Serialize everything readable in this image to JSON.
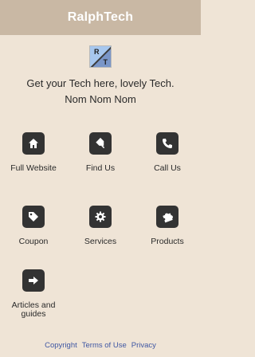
{
  "header": {
    "title": "RalphTech"
  },
  "logo": {
    "letter_1": "R",
    "letter_2": "T"
  },
  "tagline": "Get your Tech here, lovely Tech. Nom Nom Nom",
  "tiles": [
    {
      "label": "Full Website",
      "icon": "home-icon"
    },
    {
      "label": "Find Us",
      "icon": "map-pin-icon"
    },
    {
      "label": "Call Us",
      "icon": "phone-icon"
    },
    {
      "label": "Coupon",
      "icon": "tag-icon"
    },
    {
      "label": "Services",
      "icon": "gear-icon"
    },
    {
      "label": "Products",
      "icon": "puzzle-icon"
    },
    {
      "label": "Articles and guides",
      "icon": "arrow-right-icon"
    }
  ],
  "footer": {
    "links": [
      "Copyright",
      "Terms of Use",
      "Privacy"
    ]
  },
  "colors": {
    "header_bg": "#c9b8a4",
    "page_bg": "#efe4d6",
    "icon_bg": "#333333",
    "link": "#3f57a3"
  }
}
